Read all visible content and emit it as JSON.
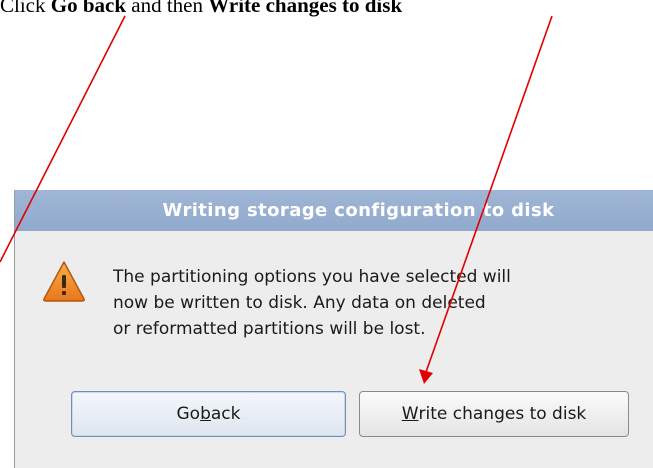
{
  "caption": {
    "prefix": "Click",
    "middle": "Go back",
    "connector": "and then",
    "action": "Write changes to disk"
  },
  "dialog": {
    "title": "Writing storage configuration to disk",
    "message_lines": [
      "The partitioning options you have selected will",
      "now be written to disk.  Any data on deleted",
      "or reformatted partitions will be lost."
    ],
    "icon": "warning-icon",
    "buttons": {
      "back": {
        "before": "Go ",
        "mnemonic": "b",
        "after": "ack"
      },
      "write": {
        "before": "",
        "mnemonic": "W",
        "after": "rite changes to disk"
      }
    }
  },
  "colors": {
    "titlebar": "#9fb6d6",
    "dialog_bg": "#ededed",
    "annotation_arrow": "#e00000",
    "warning_fill": "#f0902a"
  }
}
